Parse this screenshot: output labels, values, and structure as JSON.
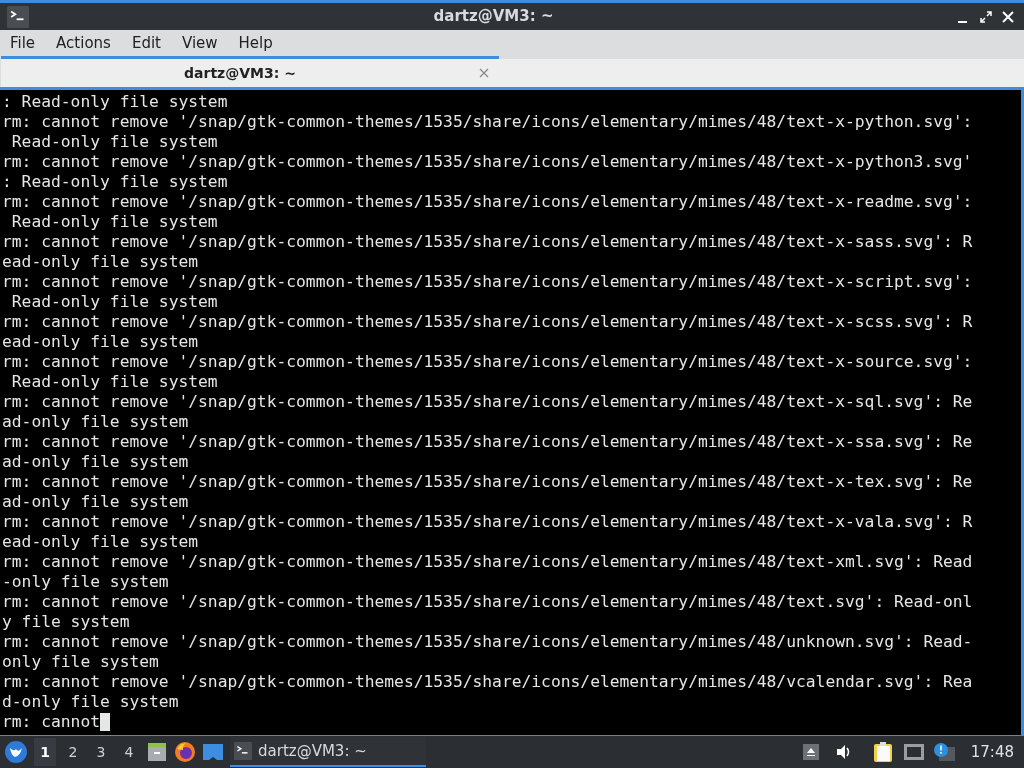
{
  "window": {
    "title": "dartz@VM3: ~"
  },
  "menu": [
    "File",
    "Actions",
    "Edit",
    "View",
    "Help"
  ],
  "tabs": [
    {
      "label": "dartz@VM3: ~",
      "selected": true
    }
  ],
  "terminal": {
    "lines": [
      ": Read-only file system",
      "rm: cannot remove '/snap/gtk-common-themes/1535/share/icons/elementary/mimes/48/text-x-python.svg':",
      " Read-only file system",
      "rm: cannot remove '/snap/gtk-common-themes/1535/share/icons/elementary/mimes/48/text-x-python3.svg'",
      ": Read-only file system",
      "rm: cannot remove '/snap/gtk-common-themes/1535/share/icons/elementary/mimes/48/text-x-readme.svg':",
      " Read-only file system",
      "rm: cannot remove '/snap/gtk-common-themes/1535/share/icons/elementary/mimes/48/text-x-sass.svg': R",
      "ead-only file system",
      "rm: cannot remove '/snap/gtk-common-themes/1535/share/icons/elementary/mimes/48/text-x-script.svg':",
      " Read-only file system",
      "rm: cannot remove '/snap/gtk-common-themes/1535/share/icons/elementary/mimes/48/text-x-scss.svg': R",
      "ead-only file system",
      "rm: cannot remove '/snap/gtk-common-themes/1535/share/icons/elementary/mimes/48/text-x-source.svg':",
      " Read-only file system",
      "rm: cannot remove '/snap/gtk-common-themes/1535/share/icons/elementary/mimes/48/text-x-sql.svg': Re",
      "ad-only file system",
      "rm: cannot remove '/snap/gtk-common-themes/1535/share/icons/elementary/mimes/48/text-x-ssa.svg': Re",
      "ad-only file system",
      "rm: cannot remove '/snap/gtk-common-themes/1535/share/icons/elementary/mimes/48/text-x-tex.svg': Re",
      "ad-only file system",
      "rm: cannot remove '/snap/gtk-common-themes/1535/share/icons/elementary/mimes/48/text-x-vala.svg': R",
      "ead-only file system",
      "rm: cannot remove '/snap/gtk-common-themes/1535/share/icons/elementary/mimes/48/text-xml.svg': Read",
      "-only file system",
      "rm: cannot remove '/snap/gtk-common-themes/1535/share/icons/elementary/mimes/48/text.svg': Read-onl",
      "y file system",
      "rm: cannot remove '/snap/gtk-common-themes/1535/share/icons/elementary/mimes/48/unknown.svg': Read-",
      "only file system",
      "rm: cannot remove '/snap/gtk-common-themes/1535/share/icons/elementary/mimes/48/vcalendar.svg': Rea",
      "d-only file system",
      "rm: cannot"
    ]
  },
  "taskbar": {
    "workspaces": [
      {
        "label": "1",
        "selected": true
      },
      {
        "label": "2",
        "selected": false
      },
      {
        "label": "3",
        "selected": false
      },
      {
        "label": "4",
        "selected": false
      }
    ],
    "tasks": [
      {
        "label": "dartz@VM3: ~",
        "selected": true
      }
    ],
    "clock": "17:48"
  }
}
